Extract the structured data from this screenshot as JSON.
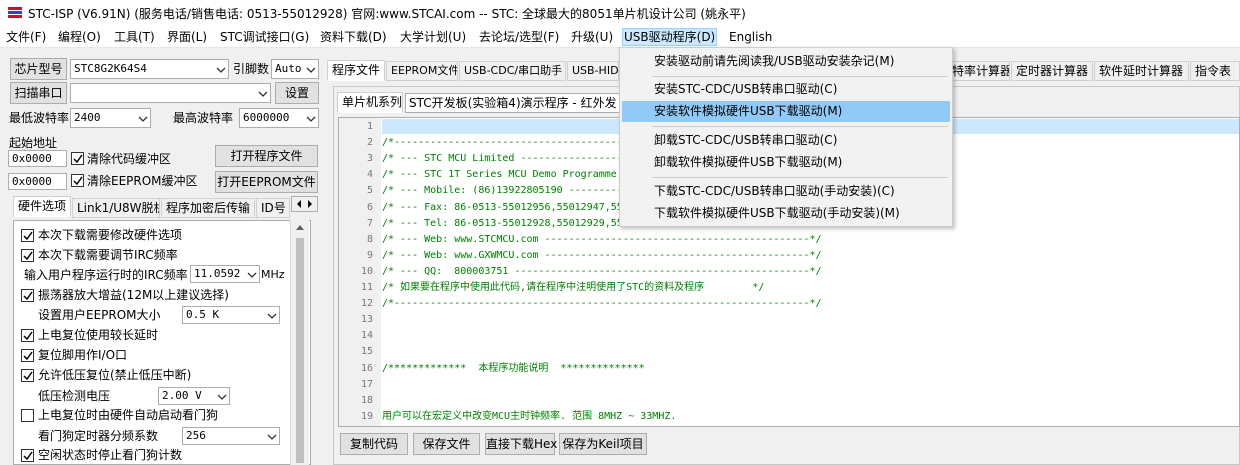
{
  "window": {
    "title": "STC-ISP (V6.91N) (服务电话/销售电话: 0513-55012928) 官网:www.STCAI.com  -- STC: 全球最大的8051单片机设计公司 (姚永平)"
  },
  "menubar": {
    "items": [
      "文件(F)",
      "编程(O)",
      "工具(T)",
      "界面(L)",
      "STC调试接口(G)",
      "资料下载(D)",
      "大学计划(U)",
      "去论坛/选型(F)",
      "升级(U)",
      "USB驱动程序(D)",
      "English"
    ]
  },
  "usb_menu": {
    "items": [
      "安装驱动前请先阅读我/USB驱动安装杂记(M)",
      "安装STC-CDC/USB转串口驱动(C)",
      "安装软件模拟硬件USB下载驱动(M)",
      "卸载STC-CDC/USB转串口驱动(C)",
      "卸载软件模拟硬件USB下载驱动(M)",
      "下载STC-CDC/USB转串口驱动(手动安装)(C)",
      "下载软件模拟硬件USB下载驱动(手动安装)(M)"
    ],
    "highlighted_index": 2
  },
  "left": {
    "chip_label": "芯片型号",
    "chip_value": "STC8G2K64S4",
    "pin_label": "引脚数",
    "pin_value": "Auto",
    "scan_button": "扫描串口",
    "port_value": "",
    "settings_button": "设置",
    "min_baud_label": "最低波特率",
    "min_baud_value": "2400",
    "max_baud_label": "最高波特率",
    "max_baud_value": "6000000",
    "start_addr_label": "起始地址",
    "addr1": "0x0000",
    "clear_code": "清除代码缓冲区",
    "open_prog": "打开程序文件",
    "addr2": "0x0000",
    "clear_eeprom": "清除EEPROM缓冲区",
    "open_eeprom": "打开EEPROM文件"
  },
  "left_tabs": [
    "硬件选项",
    "Link1/U8W脱机",
    "程序加密后传输",
    "ID号"
  ],
  "options": {
    "hw_option": "本次下载需要修改硬件选项",
    "irc_adjust": "本次下载需要调节IRC频率",
    "irc_freq_label": "输入用户程序运行时的IRC频率",
    "irc_freq_value": "11.0592",
    "irc_unit": "MHz",
    "osc_gain": "振荡器放大增益(12M以上建议选择)",
    "eeprom_size_label": "设置用户EEPROM大小",
    "eeprom_size_value": "0.5 K",
    "long_delay": "上电复位使用较长延时",
    "reset_pin": "复位脚用作I/O口",
    "lvr": "允许低压复位(禁止低压中断)",
    "lv_label": "低压检测电压",
    "lv_value": "2.00 V",
    "wdt_auto": "上电复位时由硬件自动启动看门狗",
    "wdt_div_label": "看门狗定时器分频系数",
    "wdt_div_value": "256",
    "wdt_idle": "空闲状态时停止看门狗计数"
  },
  "right_tabs": [
    "程序文件",
    "EEPROM文件",
    "USB-CDC/串口助手",
    "USB-HID助",
    "波特率计算器",
    "定时器计算器",
    "软件延时计算器",
    "指令表"
  ],
  "code_panel": {
    "series_label": "单片机系列",
    "demo_value": "STC开发板(实验箱4)演示程序 - 红外发",
    "line_numbers": [
      "1",
      "2",
      "3",
      "4",
      "5",
      "6",
      "7",
      "8",
      "9",
      "10",
      "11",
      "12",
      "13",
      "14",
      "15",
      "16",
      "17",
      "18",
      "19"
    ],
    "lines": [
      "",
      "/*---------------------------------------------------------------------*/",
      "/* --- STC MCU Limited -----------------------------------------------*/",
      "/* --- STC 1T Series MCU Demo Programme ------------------------------*/",
      "/* --- Mobile: (86)13922805190 --------------------------------------*/",
      "/* --- Fax: 86-0513-55012956,55012947,55012969 -----------------------*/",
      "/* --- Tel: 86-0513-55012928,55012929,55012966 -----------------------*/",
      "/* --- Web: www.STCMCU.com --------------------------------------------*/",
      "/* --- Web: www.GXWMCU.com --------------------------------------------*/",
      "/* --- QQ:  800003751 -------------------------------------------------*/",
      "/* 如果要在程序中使用此代码,请在程序中注明使用了STC的资料及程序        */",
      "/*---------------------------------------------------------------------*/",
      "",
      "",
      "",
      "/*************  本程序功能说明  **************",
      "",
      "",
      "用户可以在宏定义中改变MCU主时钟频率. 范围 8MHZ ~ 33MHZ."
    ],
    "copy_button": "复制代码",
    "save_button": "保存文件",
    "download_hex": "直接下载Hex",
    "save_keil": "保存为Keil项目"
  }
}
